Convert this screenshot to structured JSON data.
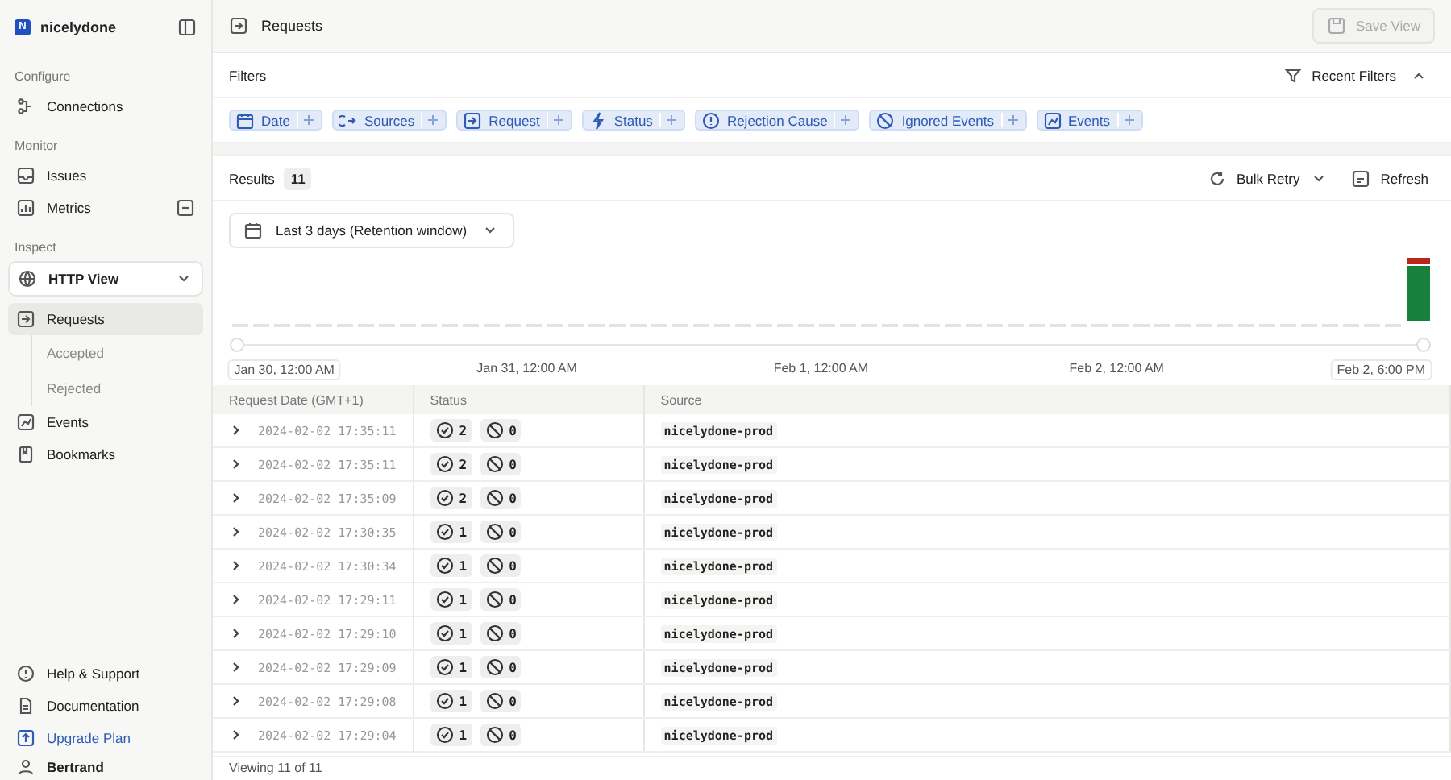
{
  "workspace": {
    "initial": "N",
    "name": "nicelydone"
  },
  "sidebar": {
    "sections": [
      {
        "title": "Configure",
        "items": [
          {
            "label": "Connections",
            "selected": false
          }
        ]
      },
      {
        "title": "Monitor",
        "items": [
          {
            "label": "Issues",
            "selected": false
          },
          {
            "label": "Metrics",
            "selected": false
          }
        ]
      },
      {
        "title": "Inspect",
        "view": "HTTP View",
        "items": [
          {
            "label": "Requests",
            "selected": true,
            "children": [
              {
                "label": "Accepted",
                "selected": false
              },
              {
                "label": "Rejected",
                "selected": false
              }
            ]
          },
          {
            "label": "Events",
            "selected": false
          },
          {
            "label": "Bookmarks",
            "selected": false
          }
        ]
      }
    ],
    "footer": [
      {
        "label": "Help & Support",
        "kind": "plain"
      },
      {
        "label": "Documentation",
        "kind": "plain"
      },
      {
        "label": "Upgrade Plan",
        "kind": "accent"
      }
    ],
    "user": "Bertrand"
  },
  "header": {
    "title": "Requests",
    "save_button": {
      "label": "Save View",
      "disabled": true
    }
  },
  "filters": {
    "title": "Filters",
    "recent": "Recent Filters",
    "expanded": true,
    "chips": [
      "Date",
      "Sources",
      "Request",
      "Status",
      "Rejection Cause",
      "Ignored Events",
      "Events"
    ]
  },
  "results": {
    "title": "Results",
    "count": "11",
    "bulk_retry": "Bulk Retry",
    "refresh": "Refresh"
  },
  "date_range": "Last 3 days (Retention window)",
  "timeline_labels": [
    "Jan 30, 12:00 AM",
    "Jan 31, 12:00 AM",
    "Feb 1, 12:00 AM",
    "Feb 2, 12:00 AM",
    "Feb 2, 6:00 PM"
  ],
  "table": {
    "columns": [
      "Request Date (GMT+1)",
      "Status",
      "Source"
    ],
    "rows": [
      {
        "date": "2024-02-02 17:35:11",
        "accepted": "2",
        "rejected": "0",
        "source": "nicelydone-prod"
      },
      {
        "date": "2024-02-02 17:35:11",
        "accepted": "2",
        "rejected": "0",
        "source": "nicelydone-prod"
      },
      {
        "date": "2024-02-02 17:35:09",
        "accepted": "2",
        "rejected": "0",
        "source": "nicelydone-prod"
      },
      {
        "date": "2024-02-02 17:30:35",
        "accepted": "1",
        "rejected": "0",
        "source": "nicelydone-prod"
      },
      {
        "date": "2024-02-02 17:30:34",
        "accepted": "1",
        "rejected": "0",
        "source": "nicelydone-prod"
      },
      {
        "date": "2024-02-02 17:29:11",
        "accepted": "1",
        "rejected": "0",
        "source": "nicelydone-prod"
      },
      {
        "date": "2024-02-02 17:29:10",
        "accepted": "1",
        "rejected": "0",
        "source": "nicelydone-prod"
      },
      {
        "date": "2024-02-02 17:29:09",
        "accepted": "1",
        "rejected": "0",
        "source": "nicelydone-prod"
      },
      {
        "date": "2024-02-02 17:29:08",
        "accepted": "1",
        "rejected": "0",
        "source": "nicelydone-prod"
      },
      {
        "date": "2024-02-02 17:29:04",
        "accepted": "1",
        "rejected": "0",
        "source": "nicelydone-prod"
      }
    ],
    "footer": "Viewing 11 of 11"
  }
}
